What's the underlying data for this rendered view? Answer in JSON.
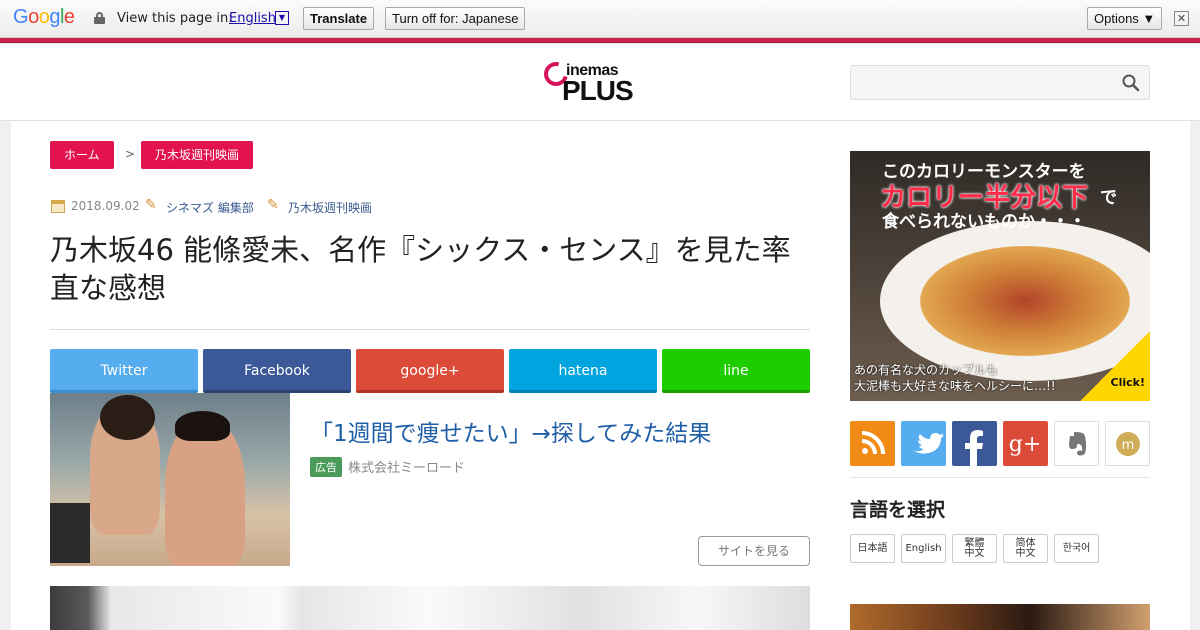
{
  "translate_bar": {
    "logo": "Google",
    "view_in": "View this page in:",
    "language": "English",
    "translate_btn": "Translate",
    "turn_off_btn": "Turn off for: Japanese",
    "options_btn": "Options ▼",
    "close": "✕"
  },
  "header": {
    "logo_top": "inemas",
    "logo_bottom": "PLUS",
    "search_placeholder": ""
  },
  "breadcrumb": {
    "home": "ホーム",
    "separator": ">",
    "category": "乃木坂週刊映画"
  },
  "article": {
    "date": "2018.09.02",
    "author": "シネマズ 編集部",
    "category": "乃木坂週刊映画",
    "title": "乃木坂46 能條愛未、名作『シックス・センス』を見た率直な感想"
  },
  "share": {
    "twitter": "Twitter",
    "facebook": "Facebook",
    "google": "google+",
    "hatena": "hatena",
    "line": "line"
  },
  "ad": {
    "title": "「1週間で痩せたい」→探してみた結果",
    "tag": "広告",
    "company": "株式会社ミーロード",
    "button": "サイトを見る"
  },
  "sidebar": {
    "banner": {
      "line1": "このカロリーモンスターを",
      "line2": "カロリー半分以下",
      "line2b": "で",
      "line3": "食べられないものか・・・",
      "line4": "あの有名な犬のカップルも",
      "line5": "大泥棒も大好きな味をヘルシーに…!!",
      "click": "Click!"
    },
    "language_heading": "言語を選択",
    "languages": {
      "ja": "日本語",
      "en": "English",
      "zt_1": "繁體",
      "zt_2": "中文",
      "zs_1": "简体",
      "zs_2": "中文",
      "ko": "한국어"
    }
  },
  "colors": {
    "accent": "#e2134e",
    "twitter": "#55acee",
    "facebook": "#3b5998",
    "google": "#dc4a38",
    "hatena": "#00a4de",
    "line": "#1dcd00"
  }
}
